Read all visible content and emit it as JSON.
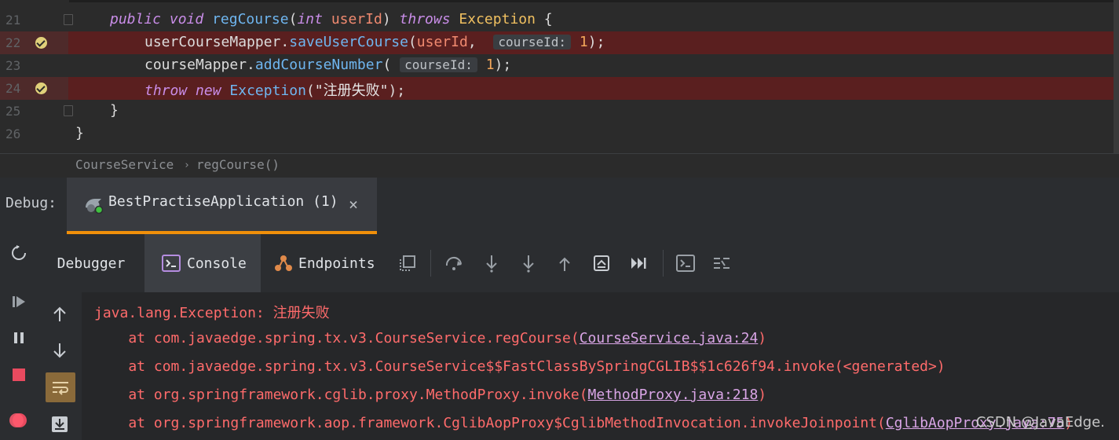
{
  "editor": {
    "lines": [
      {
        "num": "21"
      },
      {
        "num": "22"
      },
      {
        "num": "23"
      },
      {
        "num": "24"
      },
      {
        "num": "25"
      },
      {
        "num": "26"
      }
    ],
    "code": {
      "l21": {
        "kw1": "public",
        "kw2": "void",
        "fn": "regCourse",
        "open": "(",
        "kw3": "int",
        "param": "userId",
        "close": ")",
        "kw4": "throws",
        "type": "Exception",
        "brace": " {"
      },
      "l22": {
        "obj": "userCourseMapper.",
        "fn": "saveUserCourse",
        "open": "(",
        "arg": "userId",
        "comma": ", ",
        "hint": "courseId:",
        "num": "1",
        "end": ");"
      },
      "l23": {
        "obj": "courseMapper.",
        "fn": "addCourseNumber",
        "open": "( ",
        "hint": "courseId:",
        "num": "1",
        "end": ");"
      },
      "l24": {
        "kw1": "throw",
        "kw2": "new",
        "type": "Exception",
        "open": "(",
        "str": "\"注册失败\"",
        "end": ");"
      },
      "l25": {
        "text": "}"
      },
      "l26": {
        "text": "}"
      }
    }
  },
  "breadcrumb": {
    "class": "CourseService",
    "sep": "›",
    "method": "regCourse()"
  },
  "debug": {
    "label": "Debug:",
    "tab_title": "BestPractiseApplication (1)",
    "close": "×"
  },
  "toolbar": {
    "tabs": [
      {
        "label": "Debugger"
      },
      {
        "label": "Console"
      },
      {
        "label": "Endpoints"
      }
    ]
  },
  "console": {
    "lines": [
      {
        "text": "java.lang.Exception: 注册失败"
      },
      {
        "prefix": "    at com.javaedge.spring.tx.v3.CourseService.regCourse(",
        "link": "CourseService.java:24",
        "suffix": ")"
      },
      {
        "text": "    at com.javaedge.spring.tx.v3.CourseService$$FastClassBySpringCGLIB$$1c626f94.invoke(<generated>)"
      },
      {
        "prefix": "    at org.springframework.cglib.proxy.MethodProxy.invoke(",
        "link": "MethodProxy.java:218",
        "suffix": ")"
      },
      {
        "prefix": "    at org.springframework.aop.framework.CglibAopProxy$CglibMethodInvocation.invokeJoinpoint(",
        "link": "CglibAopProxy.java:75",
        "suffix": ")"
      }
    ],
    "watermark": "CSDN @JavaEdge."
  },
  "colors": {
    "accent": "#f0900a",
    "error": "#ff6b6b",
    "highlight": "#5a1f1f"
  }
}
